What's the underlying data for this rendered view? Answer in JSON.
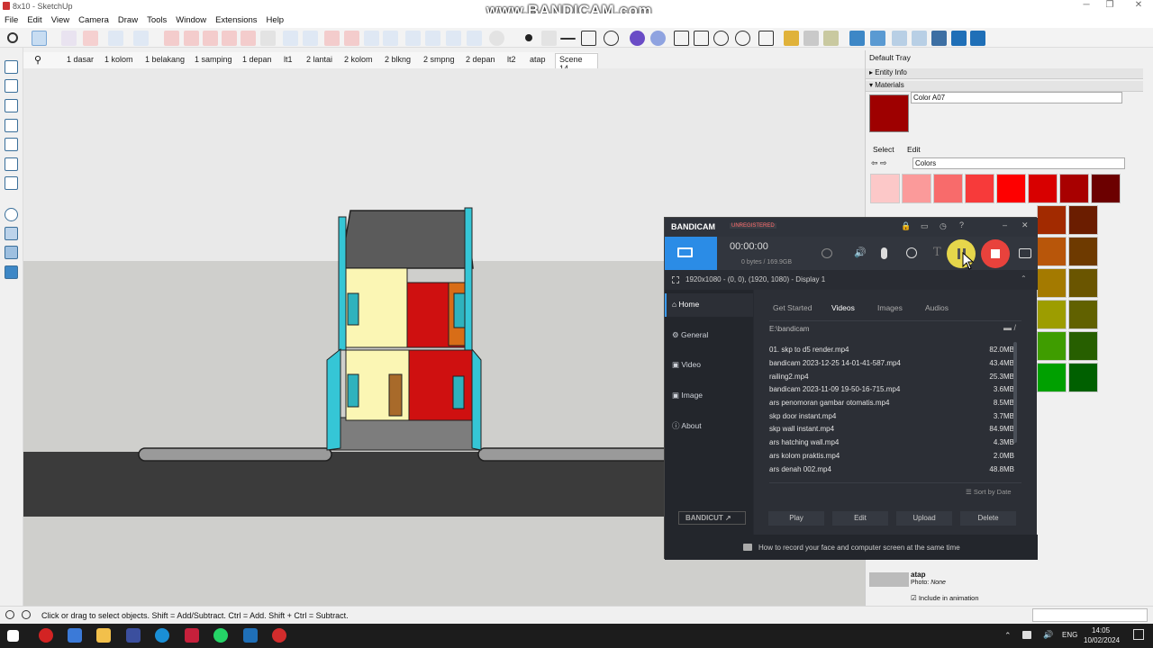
{
  "window": {
    "title": "8x10 - SketchUp"
  },
  "watermark": "www.BANDICAM.com",
  "menu": [
    "File",
    "Edit",
    "View",
    "Camera",
    "Draw",
    "Tools",
    "Window",
    "Extensions",
    "Help"
  ],
  "scenes": [
    "1 dasar",
    "1 kolom",
    "1 belakang",
    "1 samping",
    "1 depan",
    "lt1",
    "2 lantai",
    "2 kolom",
    "2 blkng",
    "2 smpng",
    "2 depan",
    "lt2",
    "atap",
    "Scene 14"
  ],
  "status": {
    "hint": "Click or drag to select objects. Shift = Add/Subtract. Ctrl = Add. Shift + Ctrl = Subtract."
  },
  "tray": {
    "title": "Default Tray",
    "entity_info": "Entity Info",
    "materials": "Materials",
    "material_name": "Color A07",
    "material_color": "#9e0000",
    "tab_select": "Select",
    "tab_edit": "Edit",
    "library": "Colors",
    "swatches": [
      "#fcc8c8",
      "#fb9a9a",
      "#f86b6b",
      "#f73a3a",
      "#fe0000",
      "#d80000",
      "#a80000",
      "#6c0000"
    ],
    "scene_name": "atap",
    "photo_label": "Photo:",
    "photo_value": "None",
    "include_animation": "Include in animation"
  },
  "bandicam": {
    "brand": "BANDICAM",
    "unregistered": "UNREGISTERED",
    "timer": "00:00:00",
    "size": "0 bytes / 169.9GB",
    "resolution": "1920x1080 - (0, 0), (1920, 1080) - Display 1",
    "nav": [
      "Home",
      "General",
      "Video",
      "Image",
      "About"
    ],
    "tabs": [
      "Get Started",
      "Videos",
      "Images",
      "Audios"
    ],
    "active_tab": "Videos",
    "path": "E:\\bandicam",
    "files": [
      {
        "name": "01. skp to d5 render.mp4",
        "size": "82.0MB"
      },
      {
        "name": "bandicam 2023-12-25 14-01-41-587.mp4",
        "size": "43.4MB"
      },
      {
        "name": "railing2.mp4",
        "size": "25.3MB"
      },
      {
        "name": "bandicam 2023-11-09 19-50-16-715.mp4",
        "size": "3.6MB"
      },
      {
        "name": "ars penomoran gambar otomatis.mp4",
        "size": "8.5MB"
      },
      {
        "name": "skp door instant.mp4",
        "size": "3.7MB"
      },
      {
        "name": "skp wall instant.mp4",
        "size": "84.9MB"
      },
      {
        "name": "ars hatching wall.mp4",
        "size": "4.3MB"
      },
      {
        "name": "ars kolom praktis.mp4",
        "size": "2.0MB"
      },
      {
        "name": "ars denah 002.mp4",
        "size": "48.8MB"
      }
    ],
    "sort": "Sort by Date",
    "actions": [
      "Play",
      "Edit",
      "Upload",
      "Delete"
    ],
    "bandicut": "BANDICUT",
    "footer": "How to record your face and computer screen at the same time"
  },
  "taskbar": {
    "lang": "ENG",
    "time": "14:05",
    "date": "10/02/2024"
  }
}
